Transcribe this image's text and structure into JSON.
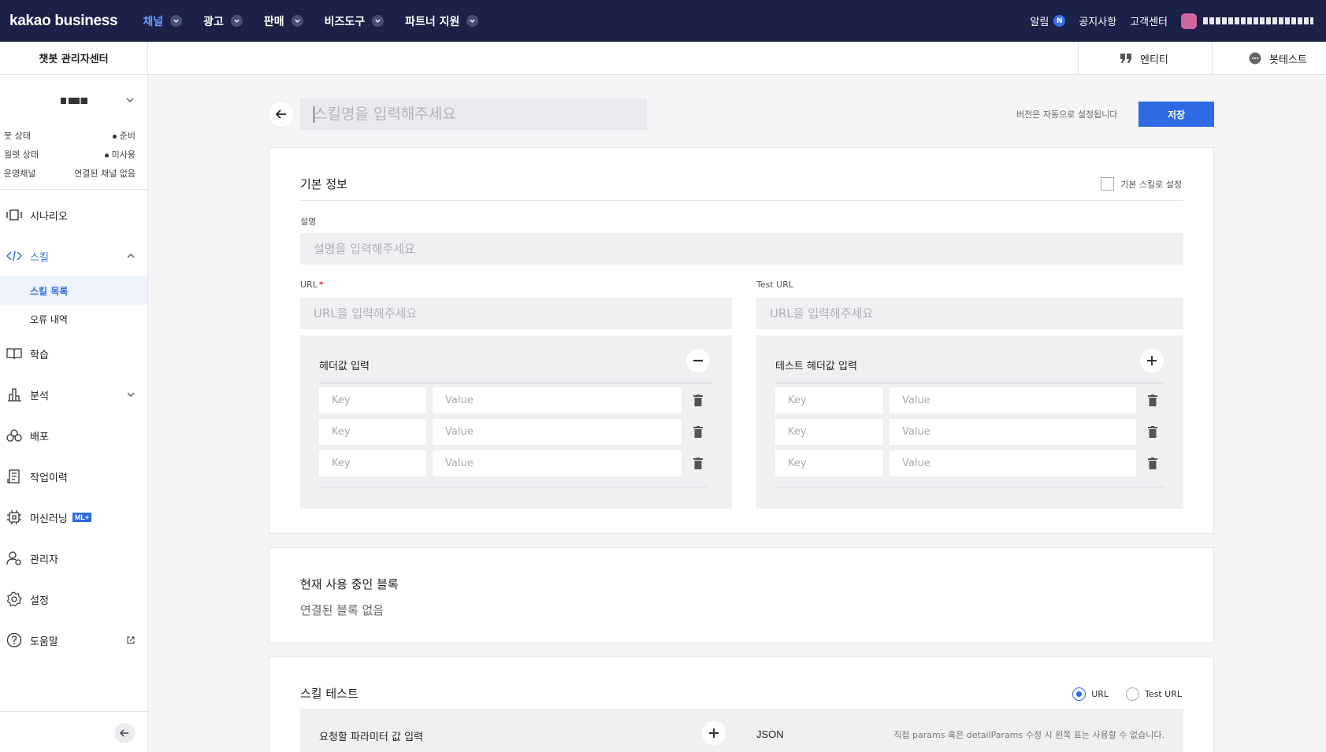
{
  "topbar": {
    "logo": "kakao business",
    "nav": [
      {
        "label": "채널",
        "active": true
      },
      {
        "label": "광고",
        "active": false
      },
      {
        "label": "판매",
        "active": false
      },
      {
        "label": "비즈도구",
        "active": false
      },
      {
        "label": "파트너 지원",
        "active": false
      }
    ],
    "alert_label": "알림",
    "alert_badge": "N",
    "notice_label": "공지사항",
    "support_label": "고객센터"
  },
  "sidebar": {
    "title": "챗봇 관리자센터",
    "status": [
      {
        "label": "봇 상태",
        "value": "준비",
        "dot": true
      },
      {
        "label": "월렛 상태",
        "value": "미사용",
        "dot": true
      },
      {
        "label": "운영채널",
        "value": "연결된 채널 없음",
        "dot": false
      }
    ],
    "menu": {
      "scenario": "시나리오",
      "skill": "스킬",
      "skill_list": "스킬 목록",
      "error_log": "오류 내역",
      "learning": "학습",
      "analysis": "분석",
      "deploy": "배포",
      "history": "작업이력",
      "ml": "머신러닝",
      "ml_badge": "ML+",
      "admin": "관리자",
      "settings": "설정",
      "help": "도움말"
    }
  },
  "subheader": {
    "entity": "엔티티",
    "bottest": "봇테스트"
  },
  "editor": {
    "skill_name_placeholder": "스킬명을 입력해주세요",
    "version_note": "버전은 자동으로 설정됩니다",
    "save_label": "저장"
  },
  "basic_info": {
    "title": "기본 정보",
    "default_skill_label": "기본 스킬로 설정",
    "desc_label": "설명",
    "desc_placeholder": "설명을 입력해주세요",
    "url_label": "URL",
    "url_required_mark": "*",
    "url_placeholder": "URL을 입력해주세요",
    "test_url_label": "Test URL",
    "test_url_placeholder": "URL을 입력해주세요",
    "header_title": "헤더값 입력",
    "test_header_title": "테스트 헤더값 입력",
    "key_placeholder": "Key",
    "value_placeholder": "Value"
  },
  "blocks": {
    "title": "현재 사용 중인 블록",
    "empty": "연결된 블록 없음"
  },
  "skill_test": {
    "title": "스킬 테스트",
    "radio_url": "URL",
    "radio_test_url": "Test URL",
    "selected": "URL",
    "params_title": "요청할 파라미터 값 입력",
    "json_label": "JSON",
    "note": "직접 params 혹은 detailParams 수정 시 왼쪽 표는 사용할 수 없습니다."
  },
  "colors": {
    "topbar": "#1b2147",
    "accent": "#2d6ae3",
    "active_nav": "#6b9bff"
  }
}
